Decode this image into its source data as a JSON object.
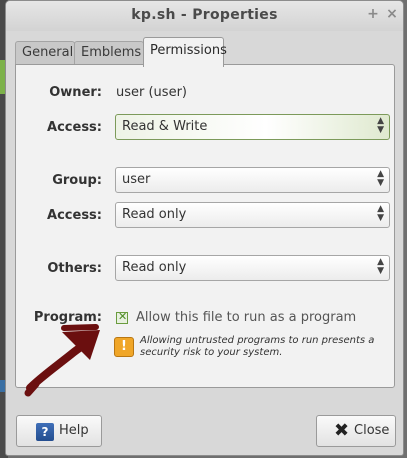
{
  "window": {
    "title": "kp.sh - Properties"
  },
  "tabs": [
    {
      "label": "General"
    },
    {
      "label": "Emblems"
    },
    {
      "label": "Permissions"
    }
  ],
  "permissions": {
    "owner_label": "Owner:",
    "owner_value": "user (user)",
    "owner_access_label": "Access:",
    "owner_access_value": "Read & Write",
    "group_label": "Group:",
    "group_value": "user",
    "group_access_label": "Access:",
    "group_access_value": "Read only",
    "others_label": "Others:",
    "others_value": "Read only",
    "program_label": "Program:",
    "program_checkbox_label": "Allow this file to run as a program",
    "program_checked": true,
    "warning_text": "Allowing untrusted programs to run presents a security risk to your system."
  },
  "buttons": {
    "help": "Help",
    "close": "Close"
  },
  "colors": {
    "annotation_arrow": "#6b0f0f",
    "checkbox_accent": "#6a9c3e",
    "warning": "#f0a628"
  }
}
